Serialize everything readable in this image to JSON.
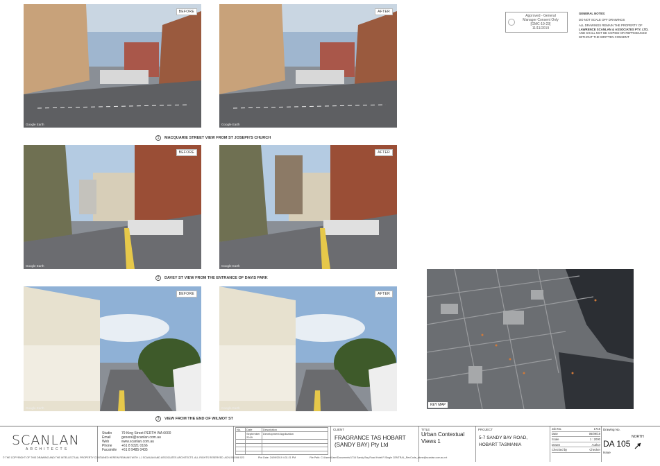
{
  "photos": [
    {
      "id": "p1-before",
      "tag": "BEFORE",
      "watermark": "Google Earth",
      "scene": "street1"
    },
    {
      "id": "p1-after",
      "tag": "AFTER",
      "watermark": "Google Earth",
      "scene": "street1"
    },
    {
      "id": "p2-before",
      "tag": "BEFORE",
      "watermark": "Google Earth",
      "scene": "street2"
    },
    {
      "id": "p2-after",
      "tag": "AFTER",
      "watermark": "Google Earth",
      "scene": "street2"
    },
    {
      "id": "p3-before",
      "tag": "BEFORE",
      "watermark": "Google Earth",
      "scene": "street3"
    },
    {
      "id": "p3-after",
      "tag": "AFTER",
      "watermark": "Google Earth",
      "scene": "street3"
    }
  ],
  "captions": [
    {
      "num": "1",
      "text": "MACQUARIE STREET VIEW FROM ST JOSEPH'S CHURCH"
    },
    {
      "num": "2",
      "text": "DAVEY ST VIEW FROM THE ENTRANCE OF DAVIS PARK"
    },
    {
      "num": "3",
      "text": "VIEW FROM THE END OF WILMOT ST"
    }
  ],
  "stamp": {
    "line1": "Approved - General",
    "line2": "Manager Consent Only",
    "line3": "[GMC-19-23]",
    "line4": "11/11/2019"
  },
  "notes": {
    "heading": "GENERAL NOTES:",
    "line1": "DO NOT SCALE OFF DRAWINGS",
    "line2": "ALL DRAWINGS REMAIN THE PROPERTY OF",
    "line3": "LAWRENCE SCANLAN & ASSOCIATES PTY. LTD.",
    "line4": "AND SHALL NOT BE COPIED OR REPRODUCED",
    "line5": "WITHOUT THE WRITTEN CONSENT"
  },
  "map": {
    "label": "KEY MAP"
  },
  "titleblock": {
    "logo": "SCANLAN",
    "logo_sub": "ARCHITECTS",
    "studio": [
      {
        "k": "Studio",
        "v": "79 King Street PERTH WA 6000"
      },
      {
        "k": "Email",
        "v": "general@scanlan.com.au"
      },
      {
        "k": "Web",
        "v": "www.scanlan.com.au"
      },
      {
        "k": "Phone",
        "v": "+61 8 9321 0166"
      },
      {
        "k": "Facsimile",
        "v": "+61 8 9485 0435"
      }
    ],
    "rev_head": {
      "no": "No.",
      "date": "Date",
      "desc": "Description"
    },
    "rev_row": {
      "no": "",
      "date": "September 2019",
      "desc": "Development Application"
    },
    "client_h": "CLIENT",
    "client_1": "FRAGRANCE TAS HOBART",
    "client_2": "(SANDY BAY) Pty Ltd",
    "title_h": "TITLE",
    "title_1": "Urban Contextual",
    "title_2": "Views 1",
    "proj_h": "PROJECT",
    "proj_1": "5-7 SANDY BAY ROAD,",
    "proj_2": "HOBART TASMANIA",
    "info": [
      {
        "k": "Job No.",
        "v": "1716"
      },
      {
        "k": "Date",
        "v": "06/09/19"
      },
      {
        "k": "Scale",
        "v": "1 : 2000"
      },
      {
        "k": "Drawn",
        "v": "Author"
      },
      {
        "k": "Checked by",
        "v": "Checker"
      }
    ],
    "dwg_h": "Drawing No.",
    "dwg_v": "DA 105",
    "north": "NORTH",
    "issue": "Issue"
  },
  "footer": {
    "copyright": "© THE COPYRIGHT OF THIS DRAWING AND THE INTELLECTUAL PROPERTY CONTAINED HEREIN REMAINS WITH L.J SCANLAN AND ASSOCIATES ARCHITECTS. ALL RIGHTS RESERVED.   ACN 008 068 023",
    "plot": "Plot Date: 24/09/2019 4:31:21 PM",
    "path": "File Path: C:\\Users\\User\\Documents\\1716 Sandy Bay Road Hotel R Single CENTRAL_RevCode_alone@scanlan.com.au.rvt"
  }
}
